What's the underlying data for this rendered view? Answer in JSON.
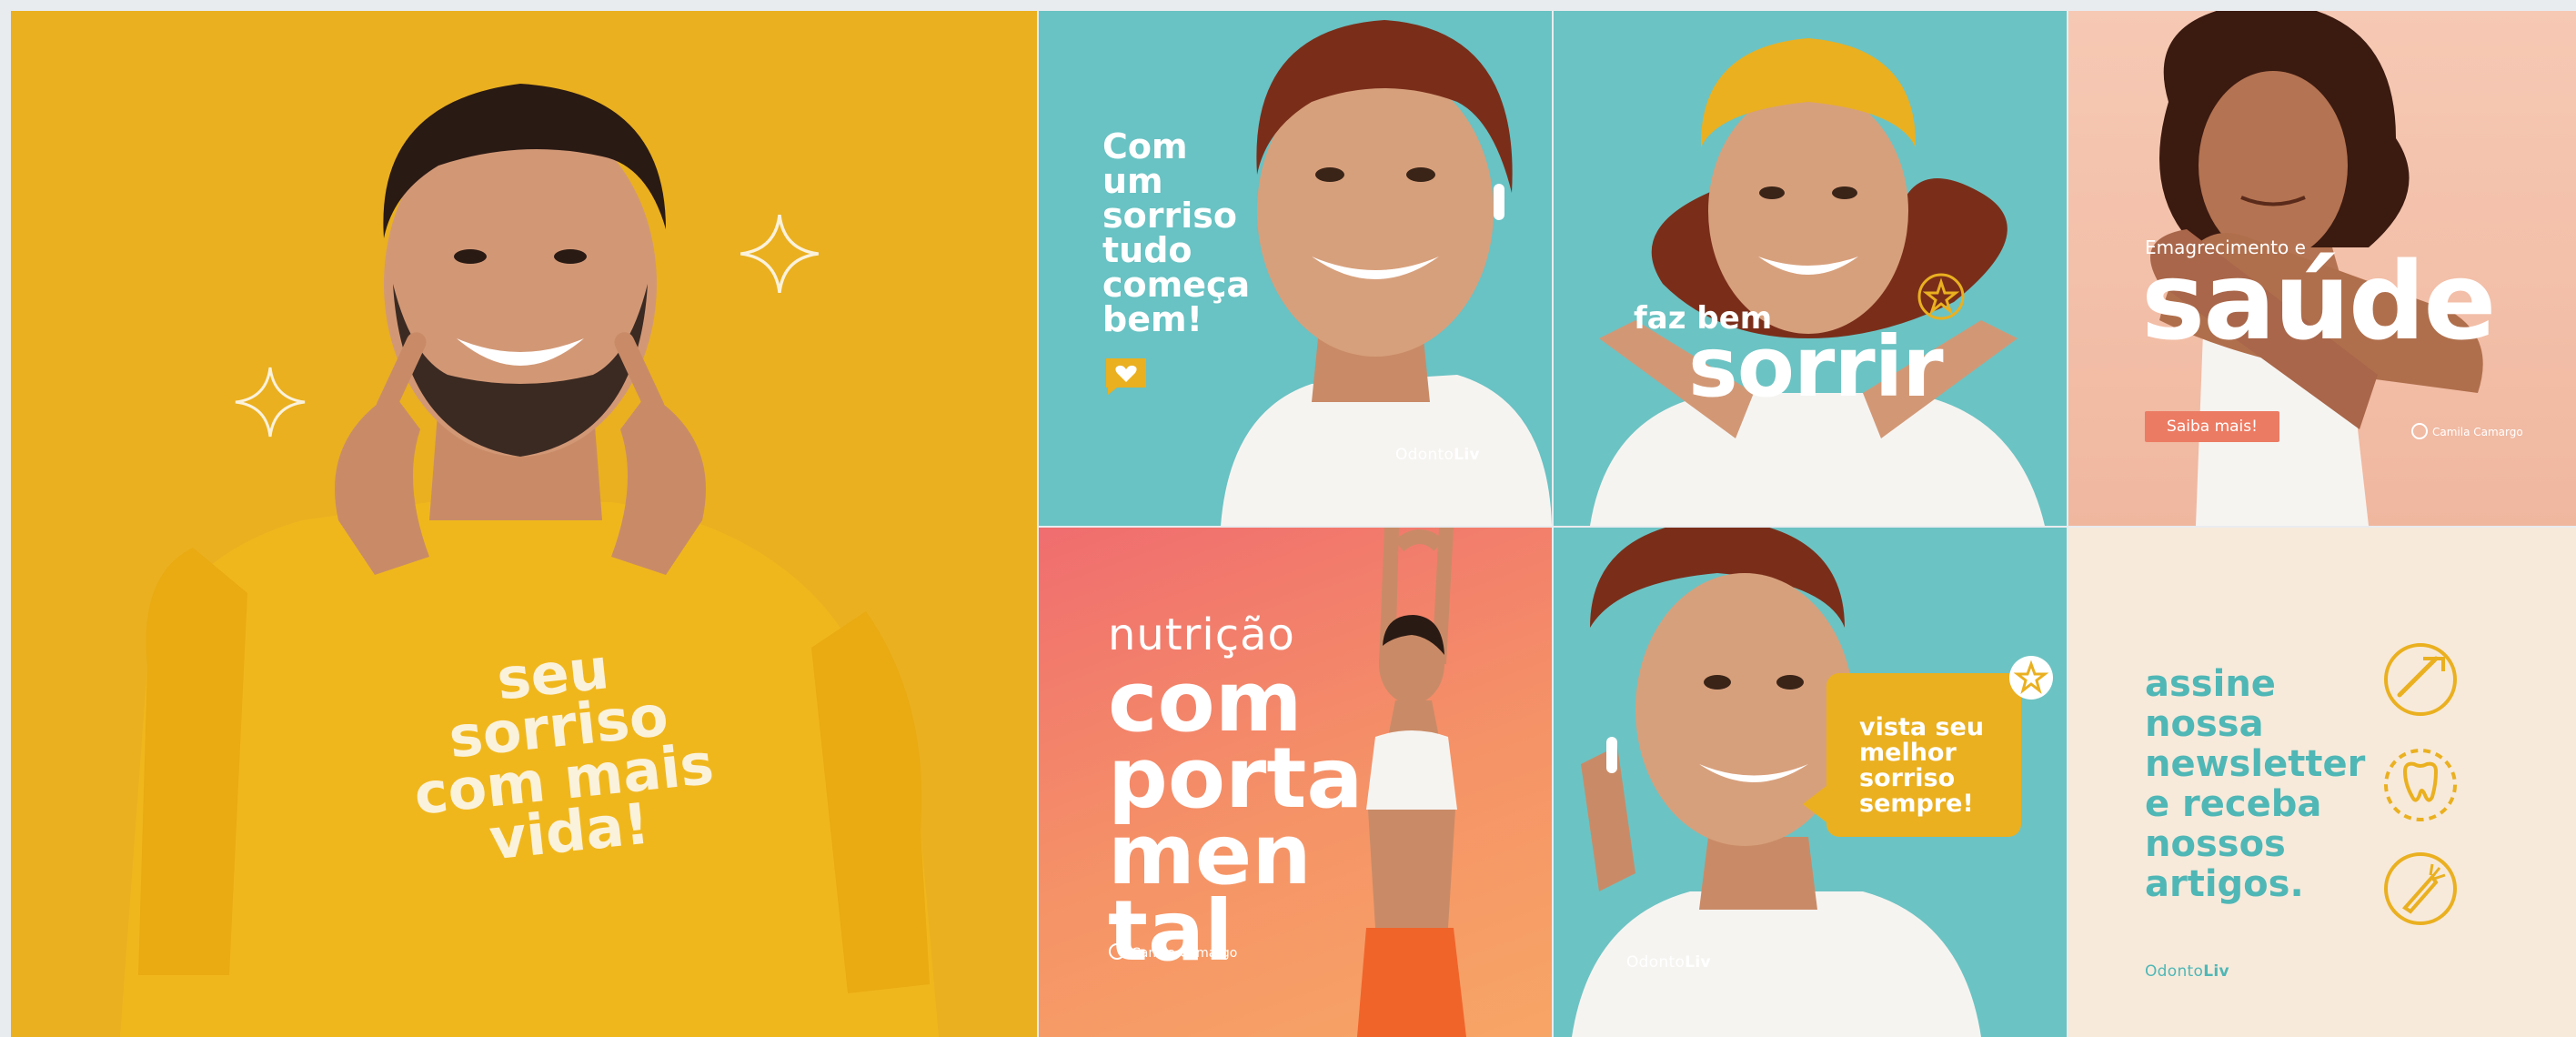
{
  "panels": {
    "p1": {
      "lines": [
        "seu",
        "sorriso",
        "com mais",
        "vida!"
      ]
    },
    "p2": {
      "lines": [
        "Com",
        "um",
        "sorriso",
        "tudo",
        "começa",
        "bem!"
      ],
      "brand_prefix": "Odonto",
      "brand_suffix": "Liv"
    },
    "p3": {
      "small": "faz bem",
      "big": "sorrir"
    },
    "p4": {
      "small": "Emagrecimento e",
      "big": "saúde",
      "button": "Saiba mais!",
      "logo": "Camila Camargo"
    },
    "p5": {
      "sub": "nutrição",
      "lines": [
        "com",
        "porta",
        "men",
        "tal"
      ],
      "logo": "Camila Camargo"
    },
    "p6": {
      "lines": [
        "vista seu",
        "melhor",
        "sorriso",
        "sempre!"
      ],
      "brand_prefix": "Odonto",
      "brand_suffix": "Liv"
    },
    "p7": {
      "lines": [
        "assine",
        "nossa",
        "newsletter",
        "e receba",
        "nossos",
        "artigos."
      ],
      "brand_prefix": "Odonto",
      "brand_suffix": "Liv"
    }
  },
  "colors": {
    "yellow": "#eab020",
    "teal": "#69c2c3",
    "peach": "#f0b79f",
    "coral": "#f06d6f",
    "cream": "#f7eadb"
  },
  "icons": [
    "sparkle-icon",
    "heart-chat-icon",
    "star-icon",
    "toothbrush-icon",
    "tooth-icon",
    "carrot-icon"
  ]
}
